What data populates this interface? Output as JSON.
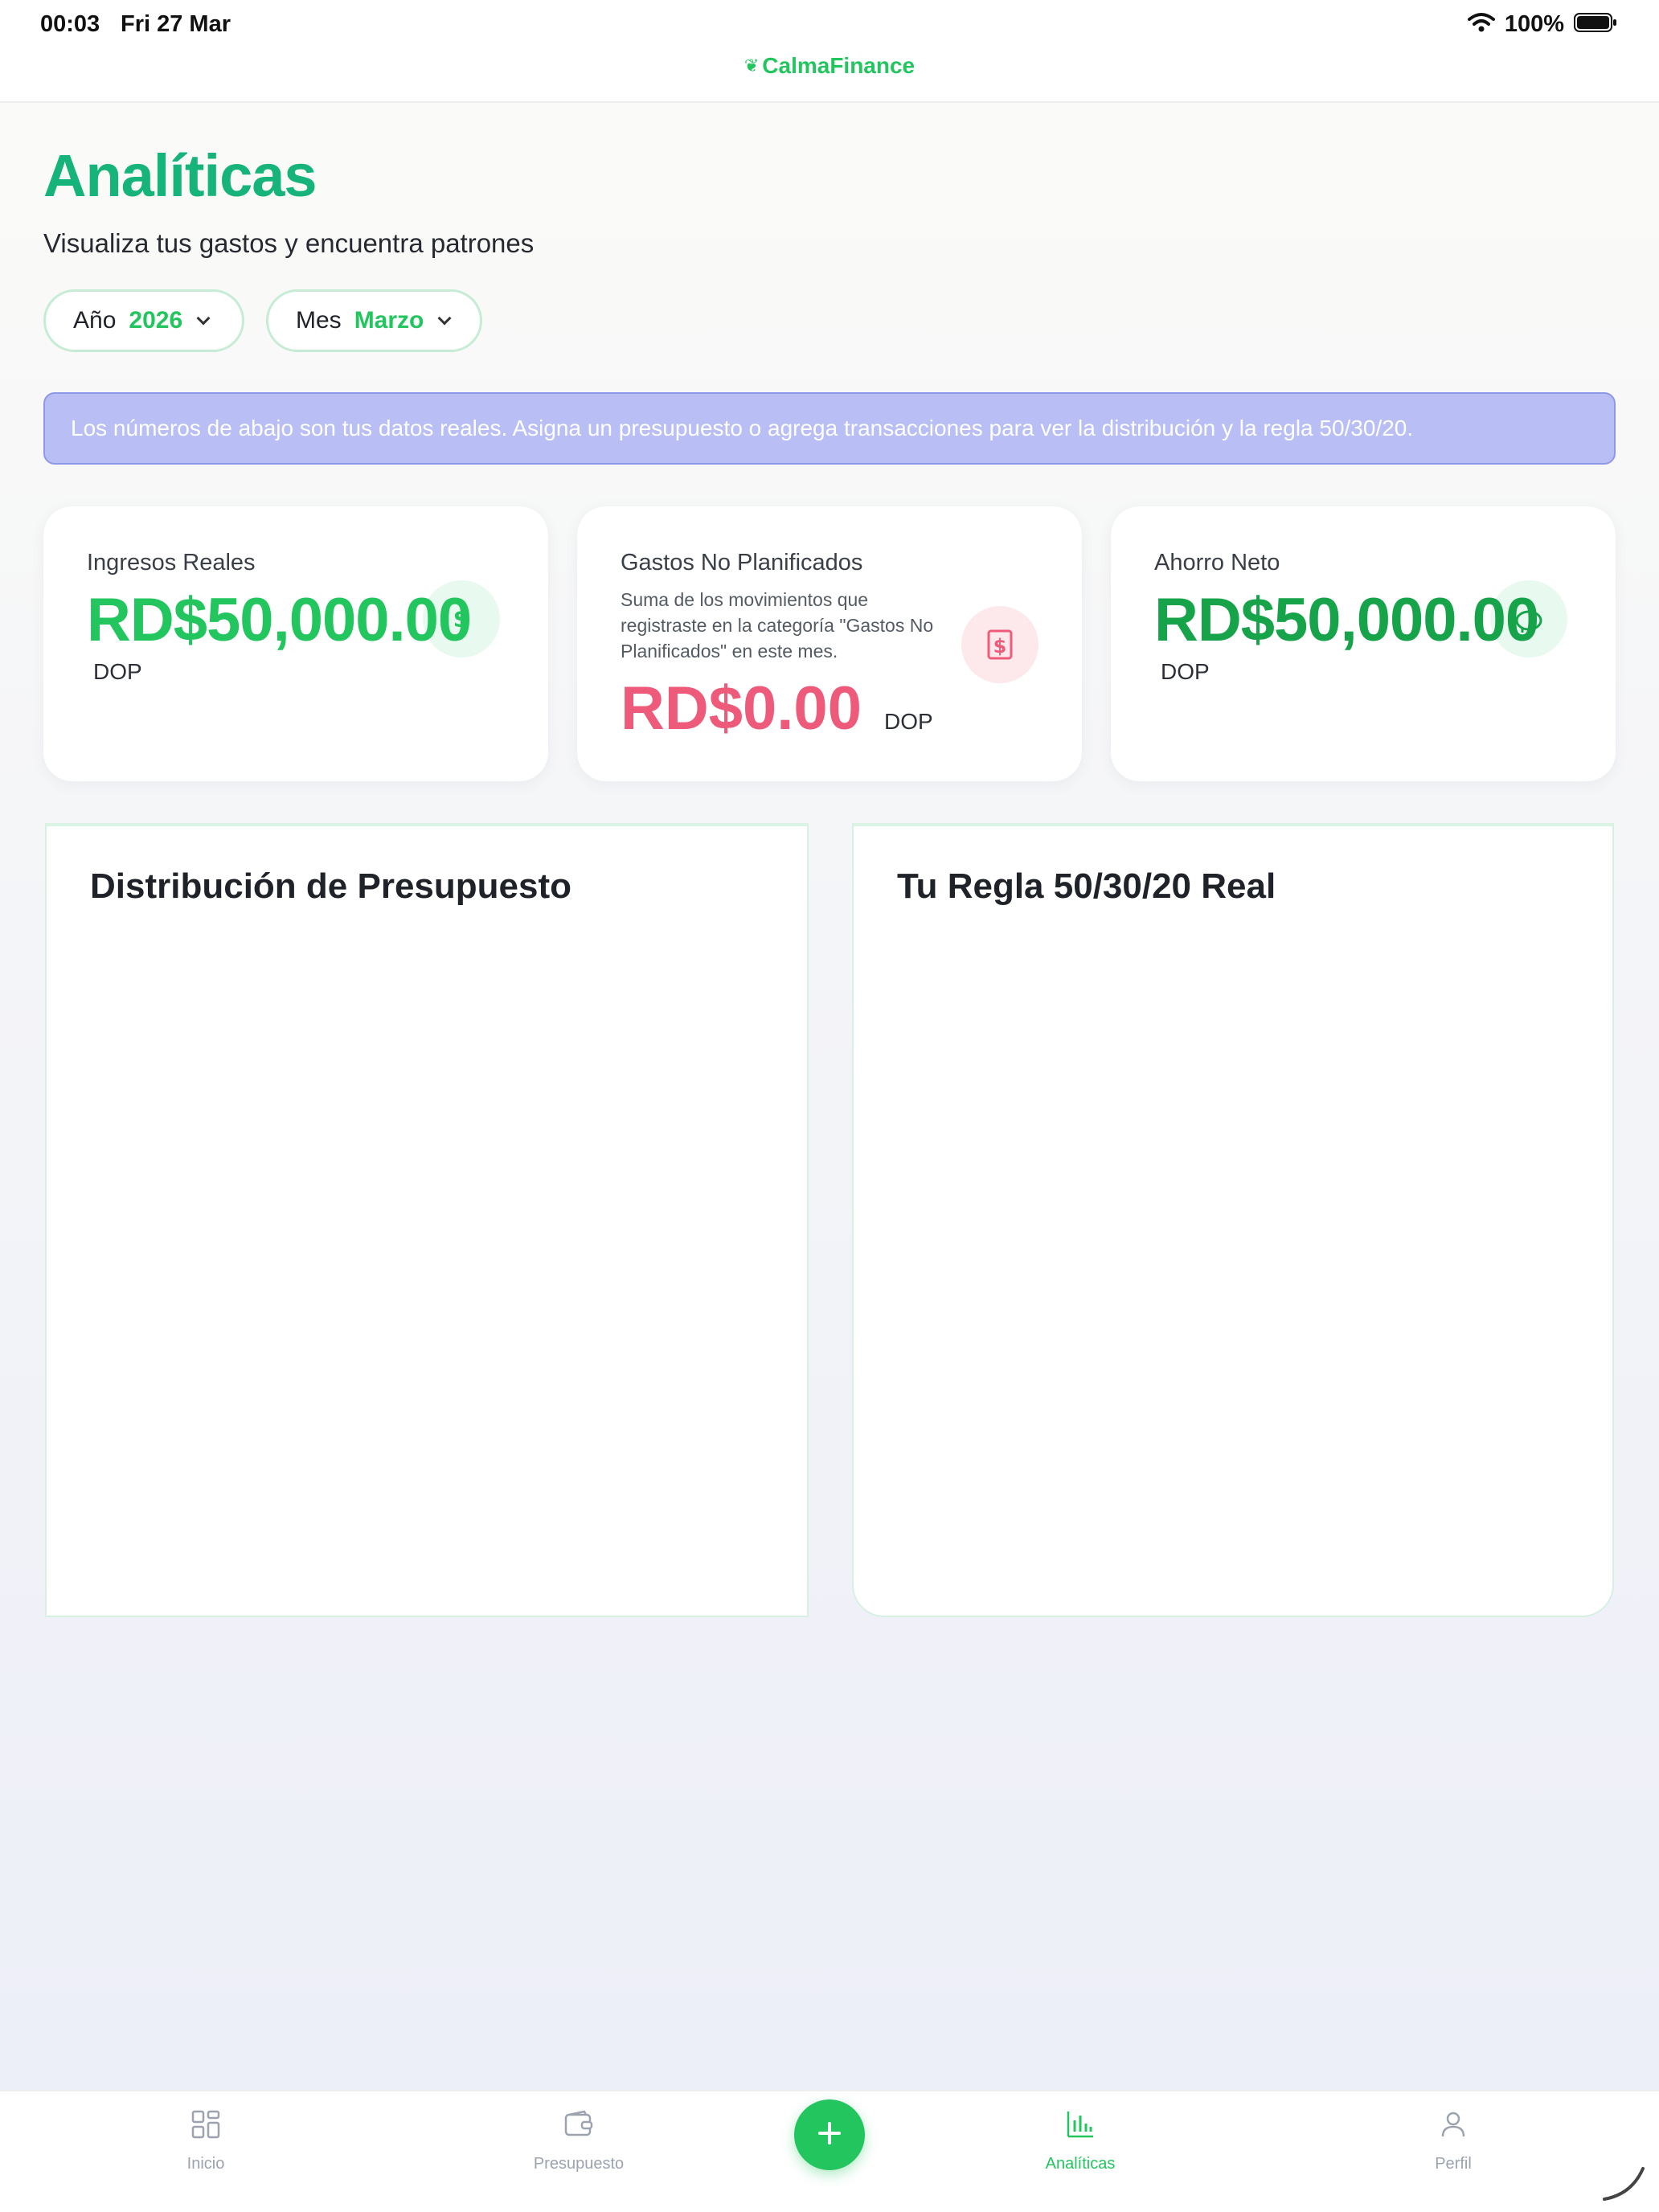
{
  "status_bar": {
    "time": "00:03",
    "date": "Fri 27 Mar",
    "battery": "100%"
  },
  "header": {
    "brand": "CalmaFinance"
  },
  "page": {
    "title": "Analíticas",
    "subtitle": "Visualiza tus gastos y encuentra patrones"
  },
  "filters": {
    "year_label": "Año",
    "year_value": "2026",
    "month_label": "Mes",
    "month_value": "Marzo"
  },
  "banner": {
    "text": "Los números de abajo son tus datos reales. Asigna un presupuesto o agrega transacciones para ver la distribución y la regla 50/30/20."
  },
  "cards": {
    "income": {
      "label": "Ingresos Reales",
      "amount": "RD$50,000.00",
      "currency": "DOP",
      "icon": "dollar-icon"
    },
    "unplanned": {
      "label": "Gastos No Planificados",
      "description": "Suma de los movimientos que registraste en la categoría \"Gastos No Planificados\" en este mes.",
      "amount": "RD$0.00",
      "currency": "DOP",
      "icon": "receipt-dollar-icon"
    },
    "savings": {
      "label": "Ahorro Neto",
      "amount": "RD$50,000.00",
      "currency": "DOP",
      "icon": "piggy-bank-icon"
    }
  },
  "panels": {
    "distribution_title": "Distribución de Presupuesto",
    "rule_title": "Tu Regla 50/30/20 Real"
  },
  "bottom_nav": {
    "items": [
      {
        "label": "Inicio",
        "icon": "grid-icon",
        "active": false
      },
      {
        "label": "Presupuesto",
        "icon": "wallet-icon",
        "active": false
      },
      {
        "label": "Analíticas",
        "icon": "bar-chart-icon",
        "active": true
      },
      {
        "label": "Perfil",
        "icon": "user-icon",
        "active": false
      }
    ],
    "fab_icon": "plus-icon"
  },
  "colors": {
    "brand_green": "#22c55e",
    "title_green": "#16b37a",
    "negative_pink": "#ee5b7a",
    "banner_bg": "#b9bff5"
  }
}
